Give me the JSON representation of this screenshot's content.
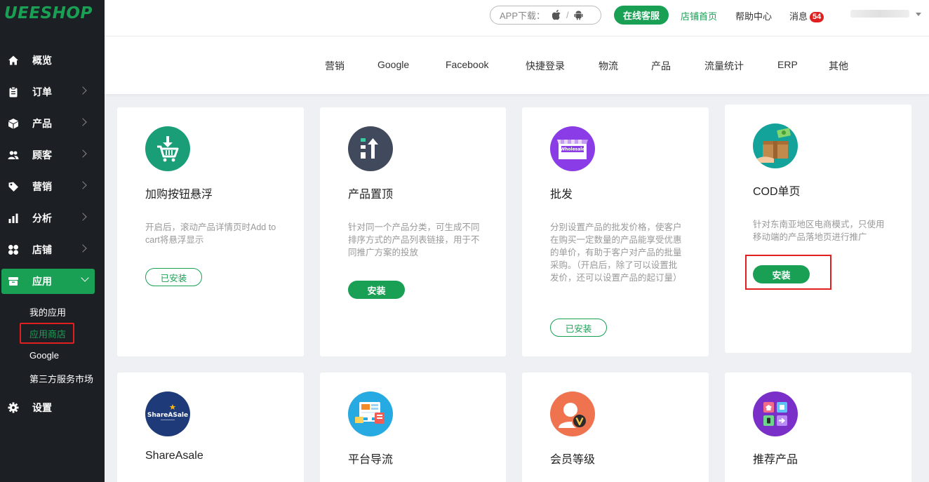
{
  "logo": "UEESHOP",
  "sidebar": {
    "items": [
      {
        "label": "概览",
        "icon": "home-icon"
      },
      {
        "label": "订单",
        "icon": "clipboard-icon"
      },
      {
        "label": "产品",
        "icon": "box-icon"
      },
      {
        "label": "顾客",
        "icon": "users-icon"
      },
      {
        "label": "营销",
        "icon": "tag-icon"
      },
      {
        "label": "分析",
        "icon": "bar-chart-icon"
      },
      {
        "label": "店铺",
        "icon": "grid-icon"
      },
      {
        "label": "应用",
        "icon": "app-icon"
      },
      {
        "label": "设置",
        "icon": "gear-icon"
      }
    ],
    "sub_items": [
      "我的应用",
      "应用商店",
      "Google",
      "第三方服务市场"
    ]
  },
  "header": {
    "app_download": "APP下载：",
    "online_service": "在线客服",
    "store_home": "店铺首页",
    "help_center": "帮助中心",
    "messages": "消息",
    "message_count": "54"
  },
  "categories": [
    "营销",
    "Google",
    "Facebook",
    "快捷登录",
    "物流",
    "产品",
    "流量统计",
    "ERP",
    "其他"
  ],
  "cards": [
    {
      "title": "加购按钮悬浮",
      "desc": "开启后，滚动产品详情页时Add to cart将悬浮显示",
      "button": "已安装"
    },
    {
      "title": "产品置顶",
      "desc": "针对同一个产品分类，可生成不同排序方式的产品列表链接，用于不同推广方案的投放",
      "button": "安装"
    },
    {
      "title": "批发",
      "desc": "分别设置产品的批发价格，使客户在购买一定数量的产品能享受优惠的单价，有助于客户对产品的批量采购。（开启后，除了可以设置批发价，还可以设置产品的起订量）",
      "button": "已安装",
      "icon_text": "Wholesale"
    },
    {
      "title": "COD单页",
      "desc": "针对东南亚地区电商模式，只使用移动端的产品落地页进行推广",
      "button": "安装"
    },
    {
      "title": "ShareAsale",
      "icon_text": "ShareASale"
    },
    {
      "title": "平台导流"
    },
    {
      "title": "会员等级"
    },
    {
      "title": "推荐产品"
    }
  ],
  "colors": {
    "brand": "#1aa055",
    "sidebar_bg": "#1c1f24",
    "highlight": "#e02020"
  }
}
